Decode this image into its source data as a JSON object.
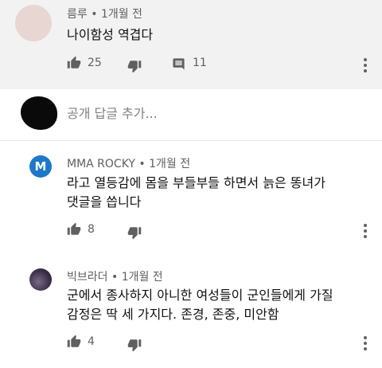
{
  "comments": [
    {
      "author": "름루",
      "time": "• 1개월 전",
      "text": "나이함성 역겹다",
      "likes": "25",
      "replies": "11"
    },
    {
      "author": "MMA ROCKY",
      "time": "• 1개월 전",
      "avatar_letter": "M",
      "avatar_color": "#1e78c8",
      "text_line1": "라고 열등감에 몸을 부들부들 하면서 늙은 똥녀가",
      "text_line2": "댓글을 씁니다",
      "likes": "8"
    },
    {
      "author": "빅브라더",
      "time": "• 1개월 전",
      "text_line1": "군에서 종사하지 아니한 여성들이 군인들에게 가질",
      "text_line2": "감정은 딱 세 가지다. 존경, 존중, 미안함",
      "likes": "4"
    }
  ],
  "reply_box": {
    "placeholder": "공개 답글 추가..."
  },
  "colors": {
    "highlight_bg": "#f2f2f2",
    "icon": "#606060",
    "divider": "#e5e5e5"
  },
  "icons": [
    "like-icon",
    "dislike-icon",
    "reply-comment-icon",
    "more-options-icon"
  ]
}
